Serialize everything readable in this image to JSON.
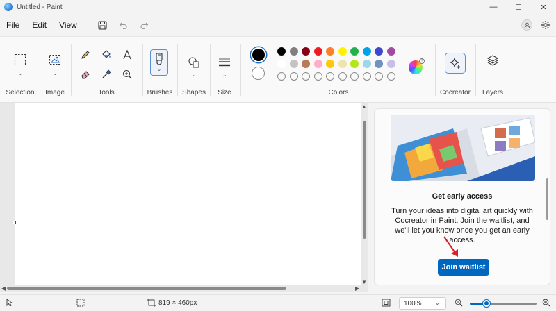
{
  "window": {
    "title": "Untitled - Paint"
  },
  "menu": {
    "file": "File",
    "edit": "Edit",
    "view": "View"
  },
  "ribbon": {
    "selection": "Selection",
    "image": "Image",
    "tools": "Tools",
    "brushes": "Brushes",
    "shapes": "Shapes",
    "size": "Size",
    "colors": "Colors",
    "cocreator": "Cocreator",
    "layers": "Layers"
  },
  "palette": {
    "primary": "#000000",
    "secondary": "#ffffff",
    "row1": [
      "#000000",
      "#7f7f7f",
      "#880015",
      "#ed1c24",
      "#ff7f27",
      "#fff200",
      "#22b14c",
      "#00a2e8",
      "#3f48cc",
      "#a349a4"
    ],
    "row2": [
      "#ffffff",
      "#c3c3c3",
      "#b97a57",
      "#ffaec9",
      "#ffc90e",
      "#efe4b0",
      "#b5e61d",
      "#99d9ea",
      "#7092be",
      "#c8bfe7"
    ]
  },
  "panel": {
    "title": "Get early access",
    "description": "Turn your ideas into digital art quickly with Cocreator in Paint. Join the waitlist, and we'll let you know once you get an early access.",
    "button": "Join waitlist",
    "accent": "#0067c0"
  },
  "status": {
    "canvas_size": "819 × 460px",
    "zoom": "100%",
    "zoom_level": 0.25
  }
}
